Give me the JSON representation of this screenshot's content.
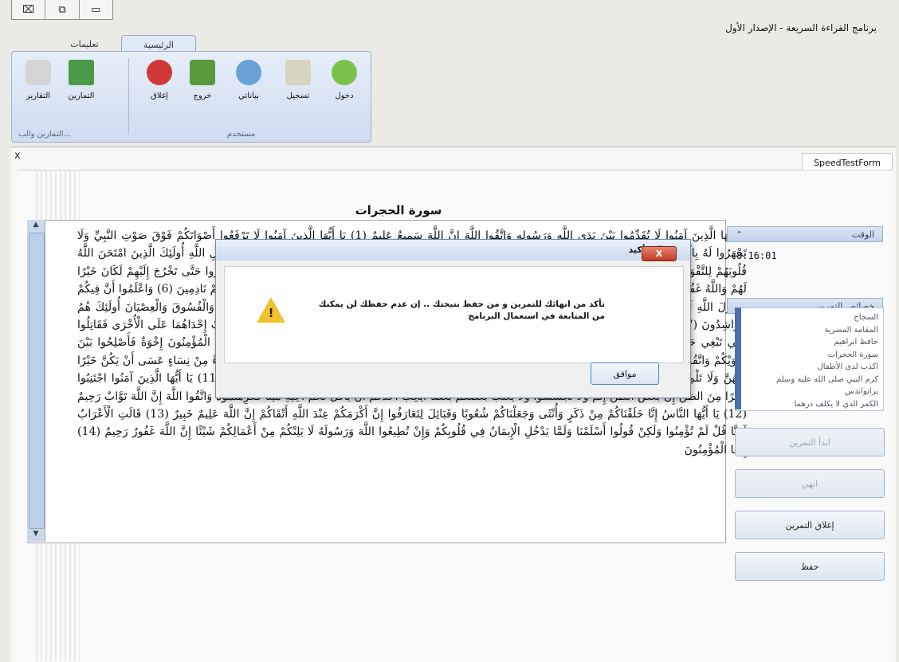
{
  "window": {
    "title": "برنامج القراءة السريعة - الإصدار الأول",
    "controls": [
      "⌧",
      "⧉",
      "▭"
    ]
  },
  "ribbon": {
    "tabs": [
      {
        "label": "الرئيسية",
        "active": true
      },
      {
        "label": "تعليمات",
        "active": false
      }
    ],
    "groups": {
      "user": {
        "label": "مستخدم",
        "buttons": [
          {
            "label": "دخول",
            "icon": "login-icon",
            "color": "#7cc24a"
          },
          {
            "label": "تسجيل",
            "icon": "register-icon",
            "color": "#d8d4c2"
          },
          {
            "label": "بياناتي",
            "icon": "user-icon",
            "color": "#6aa0d8"
          },
          {
            "label": "خروج",
            "icon": "exit-icon",
            "color": "#5a9a3c"
          },
          {
            "label": "إغلاق",
            "icon": "close-app-icon",
            "color": "#d03838"
          }
        ]
      },
      "exercises": {
        "label": "التمارين والب...",
        "buttons": [
          {
            "label": "التمارين",
            "icon": "exercises-icon",
            "color": "#4a9a48"
          },
          {
            "label": "التقارير",
            "icon": "reports-icon",
            "color": "#c9c9c9"
          }
        ]
      }
    }
  },
  "form": {
    "tab_label": "SpeedTestForm",
    "close_glyph": "x",
    "surah_title": "سورة الحجرات",
    "text": "يَا أَيُّهَا الَّذِينَ آمَنُوا لَا تُقَدِّمُوا بَيْنَ يَدَيِ اللَّهِ وَرَسُولِهِ وَاتَّقُوا اللَّهَ إِنَّ اللَّهَ سَمِيعٌ عَلِيمٌ (1) يَا أَيُّهَا الَّذِينَ آمَنُوا لَا تَرْفَعُوا أَصْوَاتَكُمْ فَوْقَ صَوْتِ النَّبِيِّ وَلَا تَجْهَرُوا لَهُ بِالْقَوْلِ كَجَهْرِ بَعْضِكُمْ لِبَعْضٍ أَنْ تَحْبَطَ أَعْمَالُكُمْ وَأَنْتُمْ لَا تَشْعُرُونَ (2) إِنَّ الَّذِينَ يَغُضُّونَ أَصْوَاتَهُمْ عِنْدَ رَسُولِ اللَّهِ أُولَئِكَ الَّذِينَ امْتَحَنَ اللَّهُ قُلُوبَهُمْ لِلتَّقْوَى لَهُمْ مَغْفِرَةٌ وَأَجْرٌ عَظِيمٌ (3) إِنَّ الَّذِينَ يُنَادُونَكَ مِنْ وَرَاءِ الْحُجُرَاتِ أَكْثَرُهُمْ لَا يَعْقِلُونَ (4) وَلَوْ أَنَّهُمْ صَبَرُوا حَتَّى تَخْرُجَ إِلَيْهِمْ لَكَانَ خَيْرًا لَهُمْ وَاللَّهُ غَفُورٌ رَحِيمٌ (5) يَا أَيُّهَا الَّذِينَ آمَنُوا إِنْ جَاءَكُمْ فَاسِقٌ بِنَبَإٍ فَتَبَيَّنُوا أَنْ تُصِيبُوا قَوْمًا بِجَهَالَةٍ فَتُصْبِحُوا عَلَى مَا فَعَلْتُمْ نَادِمِينَ (6) وَاعْلَمُوا أَنَّ فِيكُمْ رَسُولَ اللَّهِ لَوْ يُطِيعُكُمْ فِي كَثِيرٍ مِنَ الْأَمْرِ لَعَنِتُّمْ وَلَكِنَّ اللَّهَ حَبَّبَ إِلَيْكُمُ الْإِيمَانَ وَزَيَّنَهُ فِي قُلُوبِكُمْ وَكَرَّهَ إِلَيْكُمُ الْكُفْرَ وَالْفُسُوقَ وَالْعِصْيَانَ أُولَئِكَ هُمُ الرَّاشِدُونَ (7) فَضْلًا مِنَ اللَّهِ وَنِعْمَةً وَاللَّهُ عَلِيمٌ حَكِيمٌ (8) وَإِنْ طَائِفَتَانِ مِنَ الْمُؤْمِنِينَ اقْتَتَلُوا فَأَصْلِحُوا بَيْنَهُمَا فَإِنْ بَغَتْ إِحْدَاهُمَا عَلَى الْأُخْرَى فَقَاتِلُوا الَّتِي تَبْغِي حَتَّى تَفِيءَ إِلَى أَمْرِ اللَّهِ فَإِنْ فَاءَتْ فَأَصْلِحُوا بَيْنَهُمَا بِالْعَدْلِ وَأَقْسِطُوا إِنَّ اللَّهَ يُحِبُّ الْمُقْسِطِينَ (9) إِنَّمَا الْمُؤْمِنُونَ إِخْوَةٌ فَأَصْلِحُوا بَيْنَ أَخَوَيْكُمْ وَاتَّقُوا اللَّهَ لَعَلَّكُمْ تُرْحَمُونَ (10) يَا أَيُّهَا الَّذِينَ آمَنُوا لَا يَسْخَرْ قَوْمٌ مِنْ قَوْمٍ عَسَى أَنْ يَكُونُوا خَيْرًا مِنْهُمْ وَلَا نِسَاءٌ مِنْ نِسَاءٍ عَسَى أَنْ يَكُنَّ خَيْرًا مِنْهُنَّ وَلَا تَلْمِزُوا أَنْفُسَكُمْ وَلَا تَنَابَزُوا بِالْأَلْقَابِ بِئْسَ الِاسْمُ الْفُسُوقُ بَعْدَ الْإِيمَانِ وَمَنْ لَمْ يَتُبْ فَأُولَئِكَ هُمُ الظَّالِمُونَ (11) يَا أَيُّهَا الَّذِينَ آمَنُوا اجْتَنِبُوا كَثِيرًا مِنَ الظَّنِّ إِنَّ بَعْضَ الظَّنِّ إِثْمٌ وَلَا تَجَسَّسُوا وَلَا يَغْتَبْ بَعْضُكُمْ بَعْضًا أَيُحِبُّ أَحَدُكُمْ أَنْ يَأْكُلَ لَحْمَ أَخِيهِ مَيْتًا فَكَرِهْتُمُوهُ وَاتَّقُوا اللَّهَ إِنَّ اللَّهَ تَوَّابٌ رَحِيمٌ (12) يَا أَيُّهَا النَّاسُ إِنَّا خَلَقْنَاكُمْ مِنْ ذَكَرٍ وَأُنْثَى وَجَعَلْنَاكُمْ شُعُوبًا وَقَبَائِلَ لِتَعَارَفُوا إِنَّ أَكْرَمَكُمْ عِنْدَ اللَّهِ أَتْقَاكُمْ إِنَّ اللَّهَ عَلِيمٌ خَبِيرٌ (13) قَالَتِ الْأَعْرَابُ آمَنَّا قُلْ لَمْ تُؤْمِنُوا وَلَكِنْ قُولُوا أَسْلَمْنَا وَلَمَّا يَدْخُلِ الْإِيمَانُ فِي قُلُوبِكُمْ وَإِنْ تُطِيعُوا اللَّهَ وَرَسُولَهُ لَا يَلِتْكُمْ مِنْ أَعْمَالِكُمْ شَيْئًا إِنَّ اللَّهَ غَفُورٌ رَحِيمٌ (14) إِنَّمَا الْمُؤْمِنُونَ"
  },
  "side_panel": {
    "time_header": "الوقت",
    "collapse_glyph": "⌃",
    "time_value": "8:16:01",
    "list_header": "خصائص التمرين",
    "list_items": [
      "السجاح",
      "المقامة المضرية",
      "حافظ ابراهيم",
      "سورة الحجرات",
      "اكذب لدى الأطفال",
      "كرم النبي صلى الله عليه وسلم",
      "برانواندس",
      "الكمر الذي لا يكلف درهما"
    ],
    "buttons": {
      "start": "ابدأ التمرين",
      "pause": "انهي",
      "close_exercise": "إغلاق التمرين",
      "save": "حفظ"
    }
  },
  "dialog": {
    "title": "رسالة تأكيد",
    "close_label": "X",
    "message": "تأكد من انهائك للتمرين و من حفظ نتيجتك .. إن عدم حفظك لن يمكنك من المتابعة في استعمال البرنامج",
    "ok_label": "موافق",
    "warn_mark": "!"
  }
}
